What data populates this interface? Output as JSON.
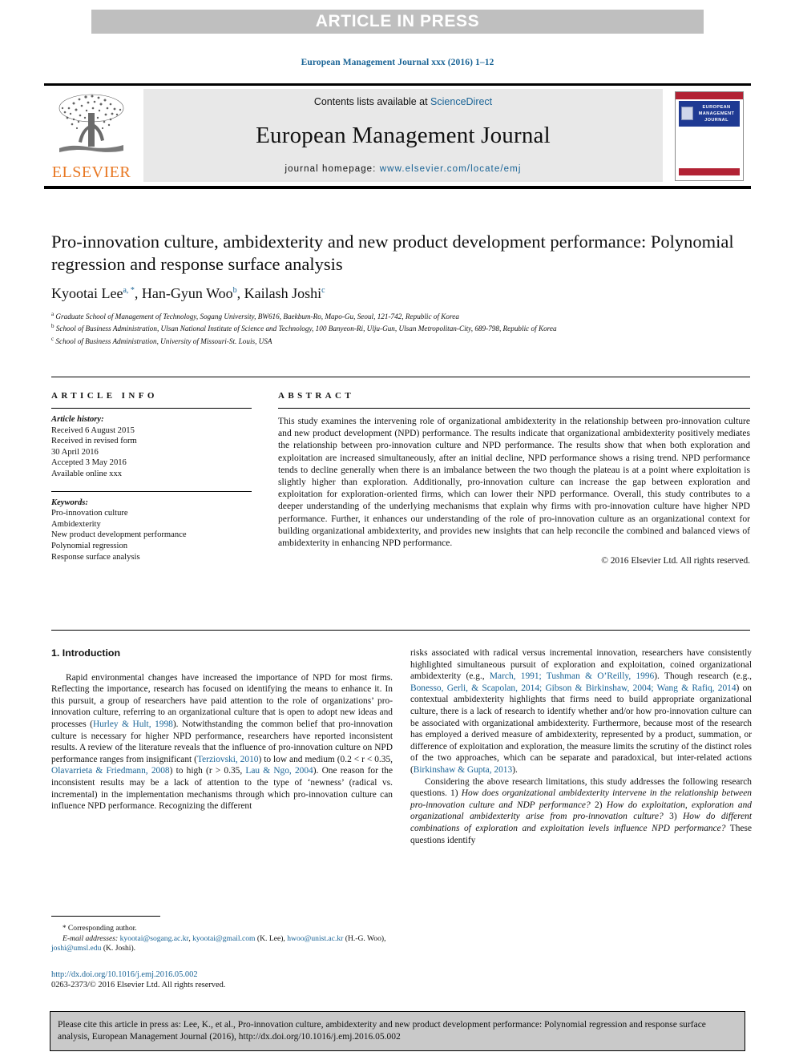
{
  "banner": {
    "text": "ARTICLE IN PRESS"
  },
  "running_head": {
    "text": "European Management Journal xxx (2016) 1–12"
  },
  "masthead": {
    "contents_prefix": "Contents lists available at ",
    "contents_link": "ScienceDirect",
    "journal_name": "European Management Journal",
    "homepage_prefix": "journal homepage: ",
    "homepage_url": "www.elsevier.com/locate/emj",
    "publisher_wordmark": "ELSEVIER",
    "cover_title": "EUROPEAN MANAGEMENT JOURNAL"
  },
  "article": {
    "title": "Pro-innovation culture, ambidexterity and new product development performance: Polynomial regression and response surface analysis",
    "authors": [
      {
        "name": "Kyootai Lee",
        "marks": "a, *"
      },
      {
        "name": "Han-Gyun Woo",
        "marks": "b"
      },
      {
        "name": "Kailash Joshi",
        "marks": "c"
      }
    ],
    "affiliations": [
      {
        "mark": "a",
        "text": "Graduate School of Management of Technology, Sogang University, BW616, Baekbum-Ro, Mapo-Gu, Seoul, 121-742, Republic of Korea"
      },
      {
        "mark": "b",
        "text": "School of Business Administration, Ulsan National Institute of Science and Technology, 100 Banyeon-Ri, Ulju-Gun, Ulsan Metropolitan-City, 689-798, Republic of Korea"
      },
      {
        "mark": "c",
        "text": "School of Business Administration, University of Missouri-St. Louis, USA"
      }
    ]
  },
  "article_info": {
    "heading": "ARTICLE INFO",
    "history_label": "Article history:",
    "history_lines": [
      "Received 6 August 2015",
      "Received in revised form",
      "30 April 2016",
      "Accepted 3 May 2016",
      "Available online xxx"
    ],
    "keywords_label": "Keywords:",
    "keywords": [
      "Pro-innovation culture",
      "Ambidexterity",
      "New product development performance",
      "Polynomial regression",
      "Response surface analysis"
    ]
  },
  "abstract": {
    "heading": "ABSTRACT",
    "text": "This study examines the intervening role of organizational ambidexterity in the relationship between pro-innovation culture and new product development (NPD) performance. The results indicate that organizational ambidexterity positively mediates the relationship between pro-innovation culture and NPD performance. The results show that when both exploration and exploitation are increased simultaneously, after an initial decline, NPD performance shows a rising trend. NPD performance tends to decline generally when there is an imbalance between the two though the plateau is at a point where exploitation is slightly higher than exploration. Additionally, pro-innovation culture can increase the gap between exploration and exploitation for exploration-oriented firms, which can lower their NPD performance. Overall, this study contributes to a deeper understanding of the underlying mechanisms that explain why firms with pro-innovation culture have higher NPD performance. Further, it enhances our understanding of the role of pro-innovation culture as an organizational context for building organizational ambidexterity, and provides new insights that can help reconcile the combined and balanced views of ambidexterity in enhancing NPD performance.",
    "copyright": "© 2016 Elsevier Ltd. All rights reserved."
  },
  "body": {
    "section_heading": "1. Introduction",
    "left_paragraphs": [
      "Rapid environmental changes have increased the importance of NPD for most firms. Reflecting the importance, research has focused on identifying the means to enhance it. In this pursuit, a group of researchers have paid attention to the role of organizations’ pro-innovation culture, referring to an organizational culture that is open to adopt new ideas and processes (Hurley & Hult, 1998). Notwithstanding the common belief that pro-innovation culture is necessary for higher NPD performance, researchers have reported inconsistent results. A review of the literature reveals that the influence of pro-innovation culture on NPD performance ranges from insignificant (Terziovski, 2010) to low and medium (0.2 < r < 0.35, Olavarrieta & Friedmann, 2008) to high (r > 0.35, Lau & Ngo, 2004). One reason for the inconsistent results may be a lack of attention to the type of ‘newness’ (radical vs. incremental) in the implementation mechanisms through which pro-innovation culture can influence NPD performance. Recognizing the different"
    ],
    "right_paragraphs": [
      "risks associated with radical versus incremental innovation, researchers have consistently highlighted simultaneous pursuit of exploration and exploitation, coined organizational ambidexterity (e.g., March, 1991; Tushman & O’Reilly, 1996). Though research (e.g., Bonesso, Gerli, & Scapolan, 2014; Gibson & Birkinshaw, 2004; Wang & Rafiq, 2014) on contextual ambidexterity highlights that firms need to build appropriate organizational culture, there is a lack of research to identify whether and/or how pro-innovation culture can be associated with organizational ambidexterity. Furthermore, because most of the research has employed a derived measure of ambidexterity, represented by a product, summation, or difference of exploitation and exploration, the measure limits the scrutiny of the distinct roles of the two approaches, which can be separate and paradoxical, but inter-related actions (Birkinshaw & Gupta, 2013).",
      "Considering the above research limitations, this study addresses the following research questions. 1) How does organizational ambidexterity intervene in the relationship between pro-innovation culture and NDP performance? 2) How do exploitation, exploration and organizational ambidexterity arise from pro-innovation culture? 3) How do different combinations of exploration and exploitation levels influence NPD performance? These questions identify"
    ],
    "inline_refs_left": [
      "Hurley & Hult, 1998",
      "Terziovski, 2010",
      "Olavarrieta & Friedmann, 2008",
      "Lau & Ngo, 2004"
    ],
    "inline_refs_right": [
      "March, 1991; Tushman & O’Reilly, 1996",
      "Bonesso, Gerli, & Scapolan, 2014; Gibson & Birkinshaw, 2004; Wang & Rafiq, 2014",
      "Birkinshaw & Gupta, 2013"
    ]
  },
  "footnotes": {
    "corresponding": "Corresponding author.",
    "email_label": "E-mail addresses:",
    "emails": [
      "kyootai@sogang.ac.kr",
      "kyootai@gmail.com",
      "hwoo@unist.ac.kr",
      "joshi@umsl.edu"
    ],
    "email_line_1a": "kyootai@sogang.ac.kr",
    "email_line_1b": "kyootai@gmail.com",
    "email_name_1": "(K. Lee),",
    "email_line_2a": "hwoo@",
    "email_line_2b": "unist.ac.kr",
    "email_name_2": "(H.-G. Woo),",
    "email_line_3": "joshi@umsl.edu",
    "email_name_3": "(K. Joshi)."
  },
  "doi_block": {
    "doi_url": "http://dx.doi.org/10.1016/j.emj.2016.05.002",
    "issn_line": "0263-2373/© 2016 Elsevier Ltd. All rights reserved."
  },
  "citation_box": {
    "text": "Please cite this article in press as: Lee, K., et al., Pro-innovation culture, ambidexterity and new product development performance: Polynomial regression and response surface analysis, European Management Journal (2016), http://dx.doi.org/10.1016/j.emj.2016.05.002"
  },
  "colors": {
    "link": "#1a6496",
    "banner_bg": "#bfbfbf",
    "masthead_bg": "#e8e8e8",
    "elsevier_orange": "#e87722",
    "cite_box_bg": "#c9c9c9",
    "cover_blue": "#1f3a93",
    "cover_red": "#b22234"
  }
}
